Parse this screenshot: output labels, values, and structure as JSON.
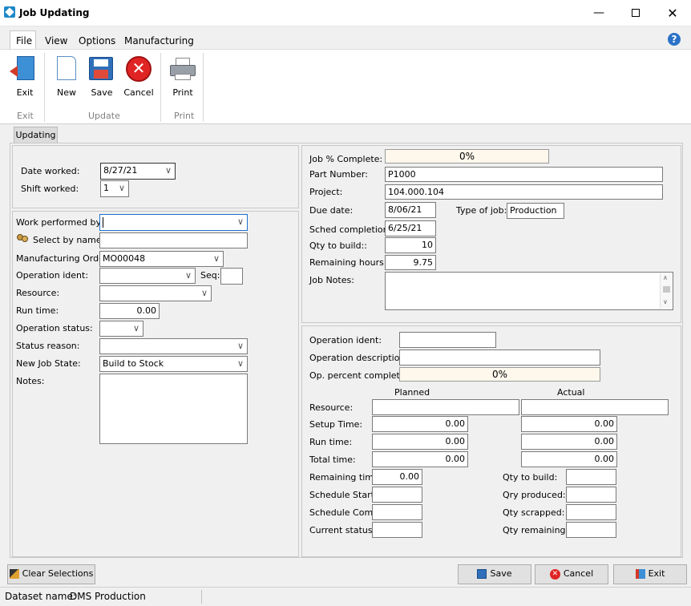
{
  "window": {
    "title": "Job Updating"
  },
  "menu": {
    "file": "File",
    "view": "View",
    "options": "Options",
    "manufacturing": "Manufacturing"
  },
  "toolbar": {
    "exit": "Exit",
    "new": "New",
    "save": "Save",
    "cancel": "Cancel",
    "print": "Print",
    "group_exit": "Exit",
    "group_update": "Update",
    "group_print": "Print"
  },
  "tab": {
    "updating": "Updating"
  },
  "left": {
    "date_worked_label": "Date worked:",
    "date_worked": "8/27/21",
    "shift_worked_label": "Shift worked:",
    "shift_worked": "1",
    "work_performed_label": "Work performed by:",
    "work_performed": "",
    "select_by_name_label": "Select by name",
    "select_by_name": "",
    "mo_label": "Manufacturing Order:",
    "mo": "MO00048",
    "op_ident_label": "Operation ident:",
    "op_ident": "",
    "seq_label": "Seq:",
    "seq": "",
    "resource_label": "Resource:",
    "resource": "",
    "run_time_label": "Run time:",
    "run_time": "0.00",
    "op_status_label": "Operation status:",
    "op_status": "",
    "status_reason_label": "Status reason:",
    "status_reason": "",
    "new_job_state_label": "New Job State:",
    "new_job_state": "Build to Stock",
    "notes_label": "Notes:",
    "notes": ""
  },
  "right_top": {
    "job_pct_label": "Job % Complete:",
    "job_pct": "0%",
    "part_number_label": "Part Number:",
    "part_number": "P1000",
    "project_label": "Project:",
    "project": "104.000.104",
    "due_date_label": "Due date:",
    "due_date": "8/06/21",
    "type_of_job_label": "Type of job:",
    "type_of_job": "Production",
    "sched_completion_label": "Sched completion:",
    "sched_completion": "6/25/21",
    "qty_to_build_label": "Qty to build::",
    "qty_to_build": "10",
    "remaining_hours_label": "Remaining hours:",
    "remaining_hours": "9.75",
    "job_notes_label": "Job Notes:",
    "job_notes": ""
  },
  "right_bottom": {
    "op_ident_label": "Operation ident:",
    "op_ident": "",
    "op_desc_label": "Operation description:",
    "op_desc": "",
    "op_pct_label": "Op. percent complete:",
    "op_pct": "0%",
    "planned_header": "Planned",
    "actual_header": "Actual",
    "resource_label": "Resource:",
    "resource_planned": "",
    "resource_actual": "",
    "setup_label": "Setup Time:",
    "setup_planned": "0.00",
    "setup_actual": "0.00",
    "run_label": "Run time:",
    "run_planned": "0.00",
    "run_actual": "0.00",
    "total_label": "Total time:",
    "total_planned": "0.00",
    "total_actual": "0.00",
    "remaining_label": "Remaining time:",
    "remaining": "0.00",
    "sched_start_label": "Schedule Start:",
    "sched_start": "",
    "sched_comp_label": "Schedule Comp:",
    "sched_comp": "",
    "current_status_label": "Current status:",
    "current_status": "",
    "qty_build_label": "Qty to build:",
    "qty_build": "",
    "qty_produced_label": "Qry produced:",
    "qty_produced": "",
    "qty_scrapped_label": "Qty scrapped:",
    "qty_scrapped": "",
    "qty_remaining_label": "Qty remaining:",
    "qty_remaining": ""
  },
  "footer": {
    "clear_selections": "Clear Selections",
    "save": "Save",
    "cancel": "Cancel",
    "exit": "Exit",
    "dataset_label": "Dataset name:",
    "dataset": "DMS Production"
  }
}
